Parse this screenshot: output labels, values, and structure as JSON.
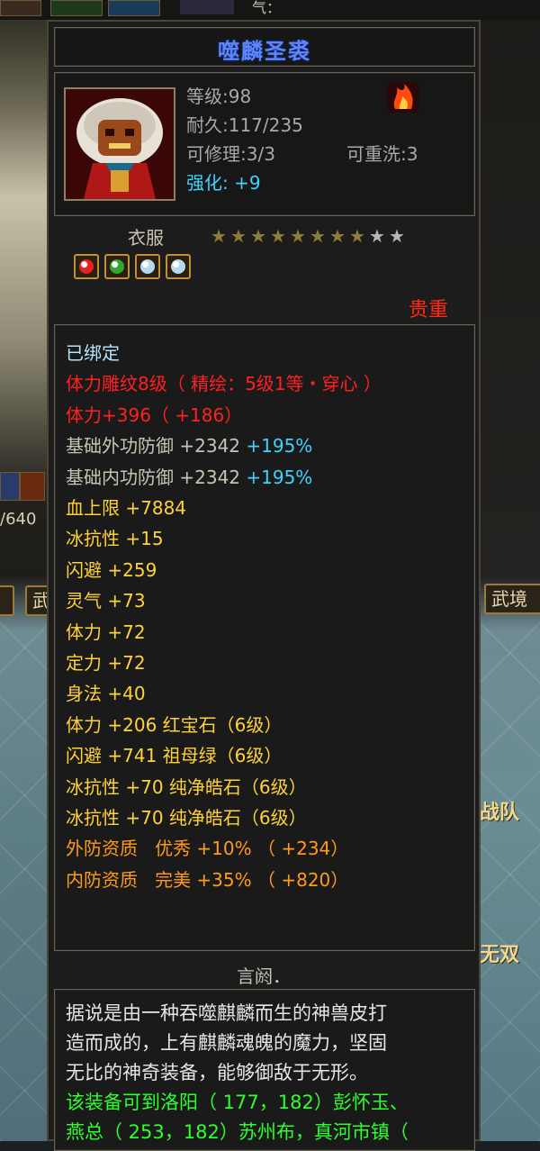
{
  "scene": {
    "top_text": "气：",
    "left_stat": "/640",
    "left_button": "武",
    "right_button": "武境",
    "right_text_1": "战队",
    "right_text_2": "无双"
  },
  "item": {
    "name": "噬麟圣裘",
    "level": "等级:98",
    "durability": "耐久:117/235",
    "repairable": "可修理:3/3",
    "rewashable": "可重洗:3",
    "strength": "强化: +9",
    "type": "衣服",
    "stars": {
      "filled": 8,
      "total": 10
    },
    "rarity": "贵重",
    "gem_colors": [
      "#e82020",
      "#2ea82e",
      "#b8d8f0",
      "#b8d8f0"
    ]
  },
  "attributes": [
    {
      "text": "已绑定",
      "color": "bound"
    },
    {
      "text": "体力雕纹8级（ 精绘：5级1等・穿心 ）",
      "color": "red"
    },
    {
      "text": "体力+396（ +186）",
      "color": "red"
    },
    {
      "text": "基础外功防御 +2342",
      "extra": " +195%",
      "color": "base"
    },
    {
      "text": "基础内功防御 +2342",
      "extra": " +195%",
      "color": "base"
    },
    {
      "text": "血上限 +7884",
      "color": "yellow"
    },
    {
      "text": "冰抗性 +15",
      "color": "yellow"
    },
    {
      "text": "闪避 +259",
      "color": "yellow"
    },
    {
      "text": "灵气 +73",
      "color": "yellow"
    },
    {
      "text": "体力 +72",
      "color": "yellow"
    },
    {
      "text": "定力 +72",
      "color": "yellow"
    },
    {
      "text": "身法 +40",
      "color": "yellow"
    },
    {
      "text": "体力 +206 红宝石（6级）",
      "color": "yellow"
    },
    {
      "text": "闪避 +741 祖母绿（6级）",
      "color": "yellow"
    },
    {
      "text": "冰抗性 +70 纯净皓石（6级）",
      "color": "yellow"
    },
    {
      "text": "冰抗性 +70 纯净皓石（6级）",
      "color": "yellow"
    },
    {
      "text": "外防资质   优秀 +10% （ +234）",
      "color": "orange"
    },
    {
      "text": "内防资质   完美 +35% （ +820）",
      "color": "orange"
    }
  ],
  "description": {
    "title": "言阏．",
    "lines": [
      "据说是由一种吞噬麒麟而生的神兽皮打",
      "造而成的，上有麒麟魂魄的魔力，坚固",
      "无比的神奇装备，能够御敌于无形。"
    ],
    "green_lines": [
      "该装备可到洛阳（ 177，182）彭怀玉、",
      "燕总（ 253，182）苏州布，真河市镇（"
    ]
  }
}
